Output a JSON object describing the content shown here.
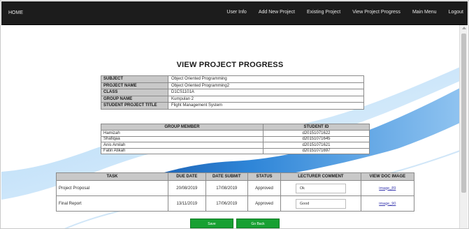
{
  "nav": {
    "home": "HOME",
    "links": [
      "User Info",
      "Add New Project",
      "Existing Project",
      "View Project Progress",
      "Main Menu",
      "Logout"
    ]
  },
  "page": {
    "title": "VIEW PROJECT PROGRESS"
  },
  "info": [
    {
      "label": "SUBJECT",
      "value": "Object Oriented Programming"
    },
    {
      "label": "PROJECT NAME",
      "value": "Object Oriented Programming2"
    },
    {
      "label": "CLASS",
      "value": "D1CS1101A"
    },
    {
      "label": "GROUP NAME",
      "value": "Kumpulan 2"
    },
    {
      "label": "STUDENT PROJECT TITLE",
      "value": "Flight Management System"
    }
  ],
  "members": {
    "headers": [
      "GROUP MEMBER",
      "STUDENT ID"
    ],
    "rows": [
      {
        "name": "Hamizah",
        "id": "d20151071622"
      },
      {
        "name": "Shafiqaa",
        "id": "d20151071645"
      },
      {
        "name": "Anis Amilah",
        "id": "d20151071621"
      },
      {
        "name": "Fatin Atikah",
        "id": "d20151071697"
      }
    ]
  },
  "tasks": {
    "headers": [
      "TASK",
      "DUE DATE",
      "DATE SUBMIT",
      "STATUS",
      "LECTURER COMMENT",
      "VIEW DOC IMAGE"
    ],
    "rows": [
      {
        "task": "Project Proposal",
        "due": "20/08/2019",
        "submit": "17/08/2019",
        "status": "Approved",
        "comment": "Ok",
        "doc": "image_89"
      },
      {
        "task": "Final Report",
        "due": "13/11/2019",
        "submit": "17/06/2019",
        "status": "Approved",
        "comment": "Good",
        "doc": "image_90"
      }
    ]
  },
  "buttons": {
    "save": "Save",
    "back": "Go Back"
  },
  "colors": {
    "navbar": "#1c1c1c",
    "swoosh": "#1f6fc4",
    "button": "#17a032"
  }
}
